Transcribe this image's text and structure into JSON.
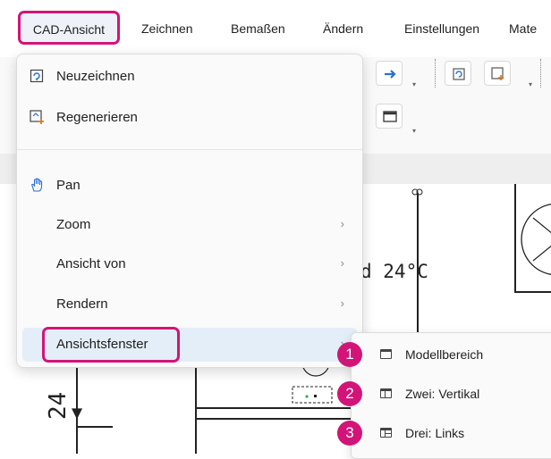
{
  "menubar": {
    "items": [
      "CAD-Ansicht",
      "Zeichnen",
      "Bemaßen",
      "Ändern",
      "Einstellungen",
      "Mate"
    ],
    "active": "CAD-Ansicht"
  },
  "dropdown": {
    "items": [
      {
        "label": "Neuzeichnen",
        "icon": "redraw-icon"
      },
      {
        "label": "Regenerieren",
        "icon": "regenerate-icon"
      },
      {
        "label": "Pan",
        "icon": "pan-hand-icon"
      },
      {
        "label": "Zoom",
        "submenu": true
      },
      {
        "label": "Ansicht von",
        "submenu": true
      },
      {
        "label": "Rendern",
        "submenu": true
      },
      {
        "label": "Ansichtsfenster",
        "submenu": true,
        "highlighted": true
      }
    ],
    "chevron": "›"
  },
  "submenu": {
    "items": [
      {
        "badge": "1",
        "label": "Modellbereich",
        "icon": "single-viewport-icon"
      },
      {
        "badge": "2",
        "label": "Zwei: Vertikal",
        "icon": "two-vertical-viewport-icon"
      },
      {
        "badge": "3",
        "label": "Drei: Links",
        "icon": "three-left-viewport-icon"
      }
    ]
  },
  "drawing": {
    "temp_label": "d 24°C",
    "dim_label": "24"
  },
  "colors": {
    "highlight_magenta": "#d21478",
    "menu_hover": "#e4eef8",
    "arrow_blue": "#2a6fd6"
  }
}
